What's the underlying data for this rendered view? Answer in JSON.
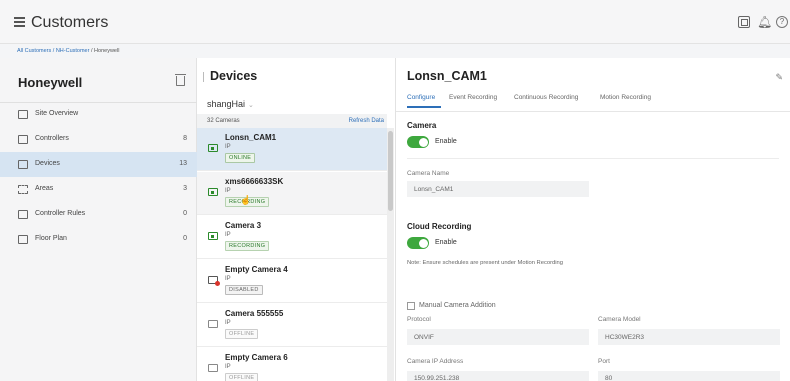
{
  "header": {
    "menu_icon": "hamburger-icon",
    "title": "Customers",
    "icons": [
      "grid-icon",
      "bell-icon",
      "help-icon"
    ],
    "help_glyph": "?"
  },
  "breadcrumb": {
    "items": [
      "All Customers",
      "NH-Customer",
      "Honeywell"
    ],
    "sep": " / "
  },
  "sidebar": {
    "site_name": "Honeywell",
    "items": [
      {
        "label": "Site Overview",
        "count": "",
        "icon": "site-overview-icon"
      },
      {
        "label": "Controllers",
        "count": "8",
        "icon": "controller-icon"
      },
      {
        "label": "Devices",
        "count": "13",
        "icon": "devices-icon",
        "active": true
      },
      {
        "label": "Areas",
        "count": "3",
        "icon": "areas-icon"
      },
      {
        "label": "Controller Rules",
        "count": "0",
        "icon": "controller-rules-icon"
      },
      {
        "label": "Floor Plan",
        "count": "0",
        "icon": "floor-plan-icon"
      }
    ]
  },
  "devices": {
    "title": "Devices",
    "site_select": "shangHai",
    "camera_count": "32 Cameras",
    "refresh_label": "Refresh Data",
    "cameras": [
      {
        "name": "Lonsn_CAM1",
        "type": "IP",
        "status": "ONLINE"
      },
      {
        "name": "xms6666633SK",
        "type": "IP",
        "status": "RECORDING"
      },
      {
        "name": "Camera 3",
        "type": "IP",
        "status": "RECORDING"
      },
      {
        "name": "Empty Camera 4",
        "type": "IP",
        "status": "DISABLED"
      },
      {
        "name": "Camera 555555",
        "type": "IP",
        "status": "OFFLINE"
      },
      {
        "name": "Empty Camera 6",
        "type": "IP",
        "status": "OFFLINE"
      }
    ]
  },
  "details": {
    "title": "Lonsn_CAM1",
    "tabs": [
      "Configure",
      "Event Recording",
      "Continuous Recording",
      "Motion Recording"
    ],
    "camera_section": "Camera",
    "enable_label": "Enable",
    "camera_name_label": "Camera Name",
    "camera_name_value": "Lonsn_CAM1",
    "cloud_section": "Cloud Recording",
    "cloud_enable_label": "Enable",
    "note": "Note: Ensure schedules are present under Motion Recording",
    "manual_label": "Manual Camera Addition",
    "protocol_label": "Protocol",
    "protocol_value": "ONVIF",
    "model_label": "Camera Model",
    "model_value": "HC30WE2R3",
    "ip_label": "Camera IP Address",
    "ip_value": "150.99.251.238",
    "port_label": "Port",
    "port_value": "80"
  },
  "colors": {
    "accent": "#2d6fb8",
    "toggle_on": "#3ea83e",
    "active_nav": "#d6e4f2"
  }
}
